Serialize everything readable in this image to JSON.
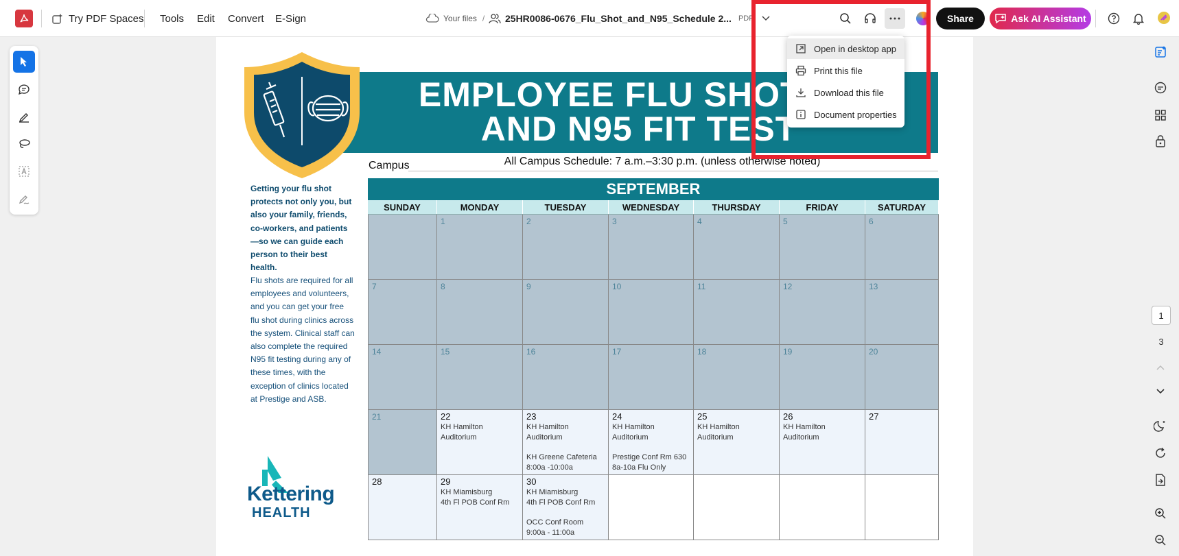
{
  "topbar": {
    "try_spaces": "Try PDF Spaces",
    "menu": [
      "Tools",
      "Edit",
      "Convert",
      "E-Sign"
    ],
    "your_files": "Your files",
    "separator": "/",
    "filename": "25HR0086-0676_Flu_Shot_and_N95_Schedule 2...",
    "filetype": "PDF",
    "share": "Share",
    "ask_ai": "Ask AI Assistant"
  },
  "dropdown": {
    "items": [
      {
        "label": "Open in desktop app",
        "icon": "open-external-icon"
      },
      {
        "label": "Print this file",
        "icon": "printer-icon"
      },
      {
        "label": "Download this file",
        "icon": "download-icon"
      },
      {
        "label": "Document properties",
        "icon": "info-icon"
      }
    ]
  },
  "pagination": {
    "current": "1",
    "total": "3"
  },
  "document": {
    "title_line1": "EMPLOYEE FLU SHOT CL",
    "title_line2": "AND N95 FIT TEST",
    "campus_label": "Campus",
    "schedule": "All Campus Schedule: 7 a.m.–3:30 p.m. (unless otherwise noted)",
    "month": "SEPTEMBER",
    "weekdays": [
      "SUNDAY",
      "MONDAY",
      "TUESDAY",
      "WEDNESDAY",
      "THURSDAY",
      "FRIDAY",
      "SATURDAY"
    ],
    "weeks": [
      [
        {
          "n": "",
          "s": "gray"
        },
        {
          "n": "1",
          "s": "gray"
        },
        {
          "n": "2",
          "s": "gray"
        },
        {
          "n": "3",
          "s": "gray"
        },
        {
          "n": "4",
          "s": "gray"
        },
        {
          "n": "5",
          "s": "gray"
        },
        {
          "n": "6",
          "s": "gray"
        }
      ],
      [
        {
          "n": "7",
          "s": "gray"
        },
        {
          "n": "8",
          "s": "gray"
        },
        {
          "n": "9",
          "s": "gray"
        },
        {
          "n": "10",
          "s": "gray"
        },
        {
          "n": "11",
          "s": "gray"
        },
        {
          "n": "12",
          "s": "gray"
        },
        {
          "n": "13",
          "s": "gray"
        }
      ],
      [
        {
          "n": "14",
          "s": "gray"
        },
        {
          "n": "15",
          "s": "gray"
        },
        {
          "n": "16",
          "s": "gray"
        },
        {
          "n": "17",
          "s": "gray"
        },
        {
          "n": "18",
          "s": "gray"
        },
        {
          "n": "19",
          "s": "gray"
        },
        {
          "n": "20",
          "s": "gray"
        }
      ],
      [
        {
          "n": "21",
          "s": "gray"
        },
        {
          "n": "22",
          "s": "light",
          "ev": [
            "KH Hamilton",
            "Auditorium"
          ]
        },
        {
          "n": "23",
          "s": "light",
          "ev": [
            "KH Hamilton",
            "Auditorium",
            "",
            "KH Greene Cafeteria",
            "8:00a -10:00a"
          ]
        },
        {
          "n": "24",
          "s": "light",
          "ev": [
            "KH Hamilton",
            "Auditorium",
            "",
            "Prestige Conf Rm 630",
            "8a-10a Flu Only"
          ]
        },
        {
          "n": "25",
          "s": "light",
          "ev": [
            "KH Hamilton",
            "Auditorium"
          ]
        },
        {
          "n": "26",
          "s": "light",
          "ev": [
            "KH Hamilton",
            "Auditorium"
          ]
        },
        {
          "n": "27",
          "s": "light"
        }
      ],
      [
        {
          "n": "28",
          "s": "light"
        },
        {
          "n": "29",
          "s": "light",
          "ev": [
            "KH Miamisburg",
            "4th Fl POB Conf Rm"
          ]
        },
        {
          "n": "30",
          "s": "light",
          "ev": [
            "KH Miamisburg",
            "4th Fl POB Conf Rm",
            "",
            "OCC Conf Room",
            "9:00a - 11:00a"
          ]
        },
        {
          "n": "",
          "s": "white"
        },
        {
          "n": "",
          "s": "white"
        },
        {
          "n": "",
          "s": "white"
        },
        {
          "n": "",
          "s": "white"
        }
      ]
    ],
    "left_bold": "Getting your flu shot protects not only you, but also your family, friends, co-workers, and patients—so we can guide each person to their best health.",
    "left_body": "Flu shots are required for all employees and volunteers, and you can get your free flu shot during clinics across the system. Clinical staff can also complete the required N95 fit testing during any of these times, with the exception of clinics located at Prestige and ASB.",
    "logo_name": "Kettering",
    "logo_sub": "HEALTH"
  },
  "colors": {
    "teal": "#0e7a8a",
    "accent_red": "#e8232e",
    "brand_blue": "#1473e6"
  }
}
